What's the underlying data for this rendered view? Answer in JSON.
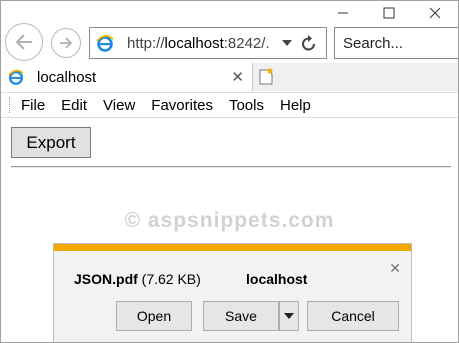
{
  "browser": {
    "address_prefix": "http://",
    "address_host": "localhost",
    "address_suffix": ":8242/.",
    "search_placeholder": "Search...",
    "tab_title": "localhost"
  },
  "menu": [
    "File",
    "Edit",
    "View",
    "Favorites",
    "Tools",
    "Help"
  ],
  "page": {
    "export_label": "Export",
    "watermark": "© aspsnippets.com"
  },
  "download": {
    "file_name": "JSON.pdf",
    "file_size": "(7.62 KB)",
    "host": "localhost",
    "open_label": "Open",
    "save_label": "Save",
    "cancel_label": "Cancel"
  },
  "colors": {
    "accent": "#f0a800",
    "ie_blue": "#1d8ce0"
  }
}
